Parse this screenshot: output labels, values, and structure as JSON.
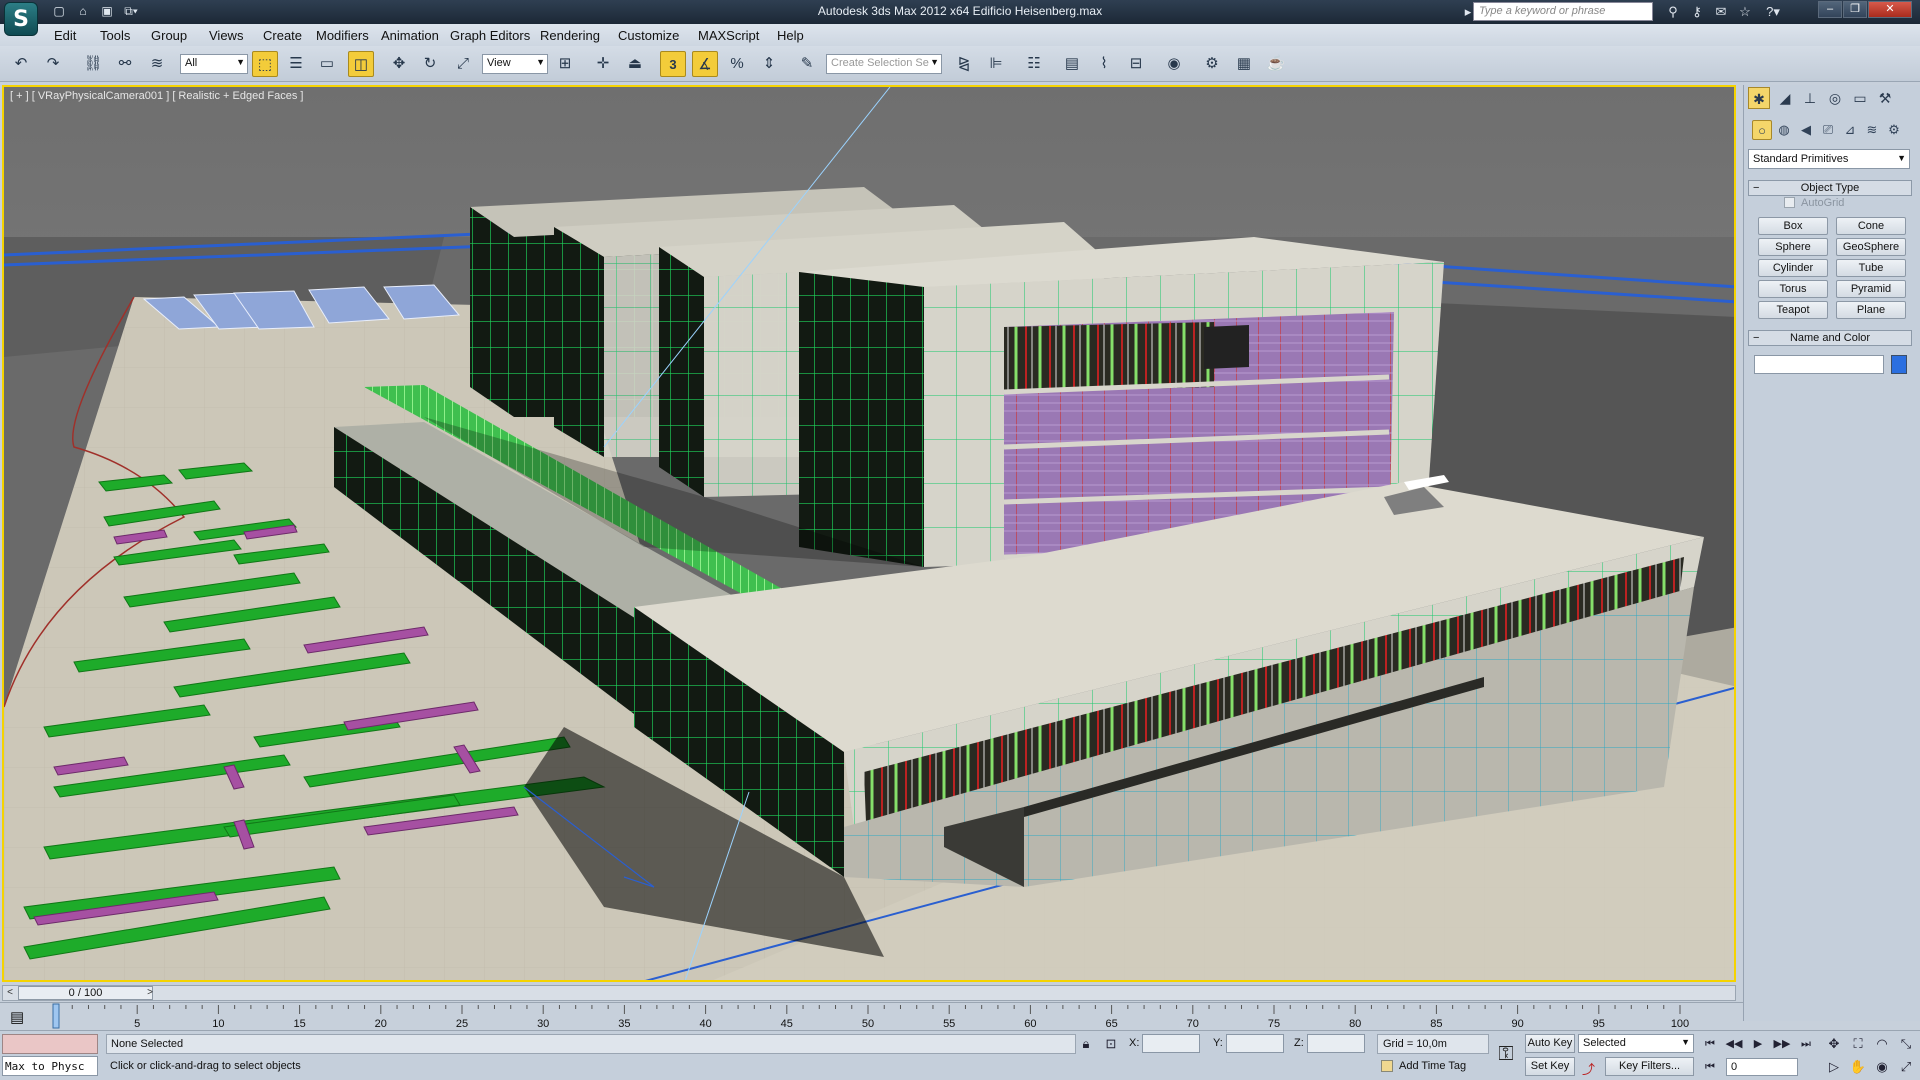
{
  "titlebar": {
    "title": "Autodesk 3ds Max  2012 x64     Edificio Heisenberg.max",
    "search_placeholder": "Type a keyword or phrase"
  },
  "menu": [
    "Edit",
    "Tools",
    "Group",
    "Views",
    "Create",
    "Modifiers",
    "Animation",
    "Graph Editors",
    "Rendering",
    "Customize",
    "MAXScript",
    "Help"
  ],
  "toolbar": {
    "filter": "All",
    "ref_coord": "View",
    "snap_label": "3",
    "selection_set_placeholder": "Create Selection Se"
  },
  "viewport": {
    "label": "[ + ] [ VRayPhysicalCamera001 ] [ Realistic + Edged Faces ]",
    "border_color": "#f5d300"
  },
  "command_panel": {
    "category": "Standard Primitives",
    "object_type_title": "Object Type",
    "autogrid": "AutoGrid",
    "primitives": [
      "Box",
      "Cone",
      "Sphere",
      "GeoSphere",
      "Cylinder",
      "Tube",
      "Torus",
      "Pyramid",
      "Teapot",
      "Plane"
    ],
    "name_color_title": "Name and Color",
    "object_color": "#2b6fe0"
  },
  "timeline": {
    "slider": "0 / 100",
    "ticks": [
      "5",
      "10",
      "15",
      "20",
      "25",
      "30",
      "35",
      "40",
      "45",
      "50",
      "55",
      "60",
      "65",
      "70",
      "75",
      "80",
      "85",
      "90",
      "95",
      "100"
    ]
  },
  "status": {
    "maxscript": "Max to Physc",
    "selection": "None Selected",
    "prompt": "Click or click-and-drag to select objects",
    "x_label": "X:",
    "y_label": "Y:",
    "z_label": "Z:",
    "grid": "Grid = 10,0m",
    "time_tag": "Add Time Tag",
    "auto_key": "Auto Key",
    "set_key": "Set Key",
    "key_mode": "Selected",
    "key_filters": "Key Filters...",
    "frame": "0"
  }
}
